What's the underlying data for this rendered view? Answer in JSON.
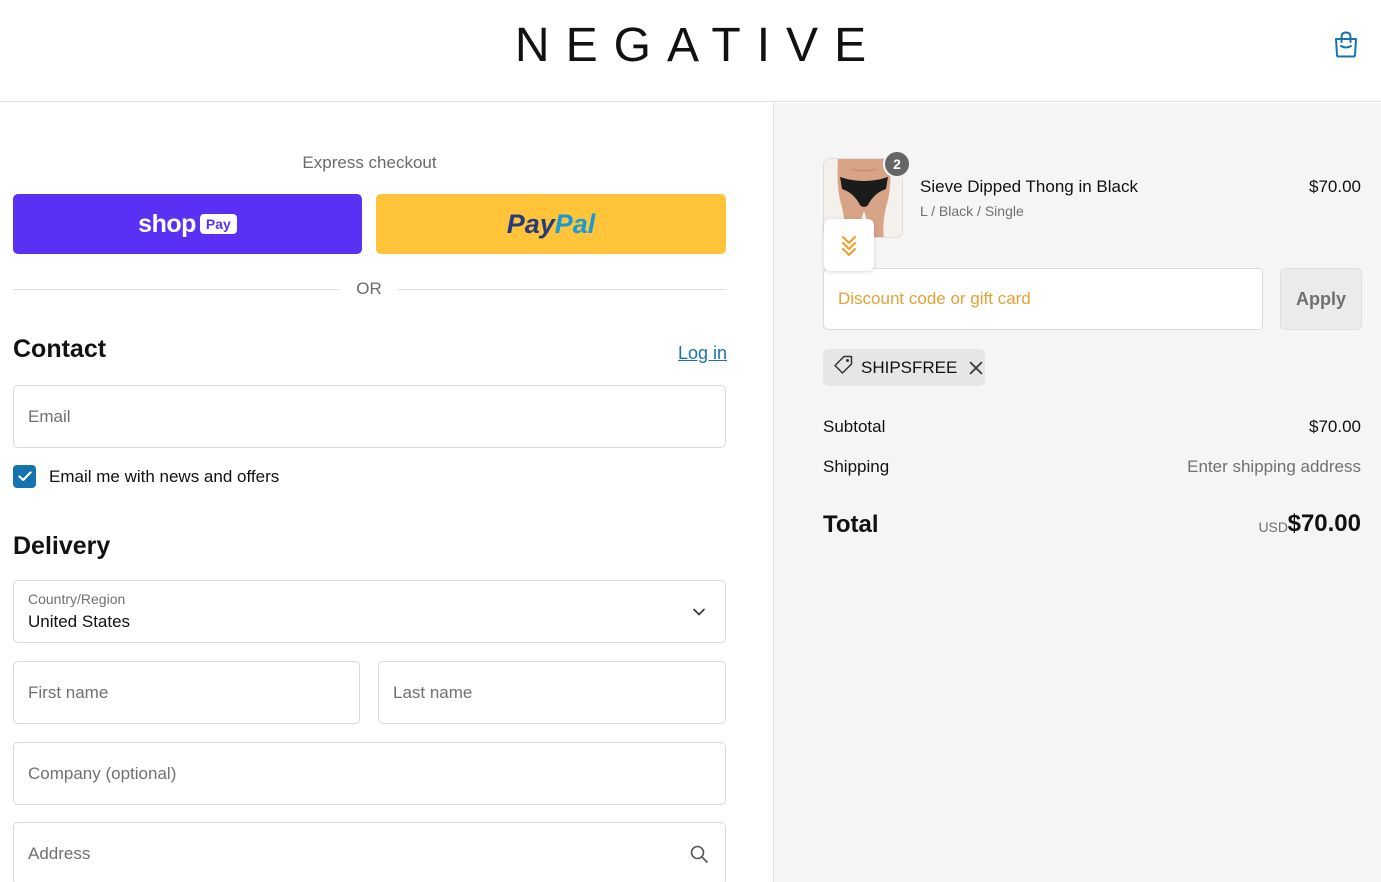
{
  "header": {
    "logo": "NEGATIVE",
    "bag_icon": "shopping-bag-icon"
  },
  "express": {
    "label": "Express checkout",
    "shoppay_word": "shop",
    "shoppay_pay": "Pay",
    "paypal_part1": "Pay",
    "paypal_part2": "Pal",
    "or_label": "OR"
  },
  "contact": {
    "title": "Contact",
    "login_link": "Log in",
    "email_placeholder": "Email",
    "newsletter_label": "Email me with news and offers",
    "newsletter_checked": true
  },
  "delivery": {
    "title": "Delivery",
    "country_label": "Country/Region",
    "country_value": "United States",
    "first_name_placeholder": "First name",
    "last_name_placeholder": "Last name",
    "company_placeholder": "Company (optional)",
    "address_placeholder": "Address"
  },
  "summary": {
    "product": {
      "name": "Sieve Dipped Thong in Black",
      "variant": "L / Black / Single",
      "price": "$70.00",
      "quantity": "2"
    },
    "discount_placeholder": "Discount code or gift card",
    "apply_label": "Apply",
    "applied_code": "SHIPSFREE",
    "subtotal_label": "Subtotal",
    "subtotal_value": "$70.00",
    "shipping_label": "Shipping",
    "shipping_value": "Enter shipping address",
    "total_label": "Total",
    "total_currency": "USD",
    "total_value": "$70.00"
  },
  "colors": {
    "shoppay": "#5a31f4",
    "paypal": "#ffc439",
    "link": "#1773b0",
    "discount_placeholder": "#e5a133"
  }
}
